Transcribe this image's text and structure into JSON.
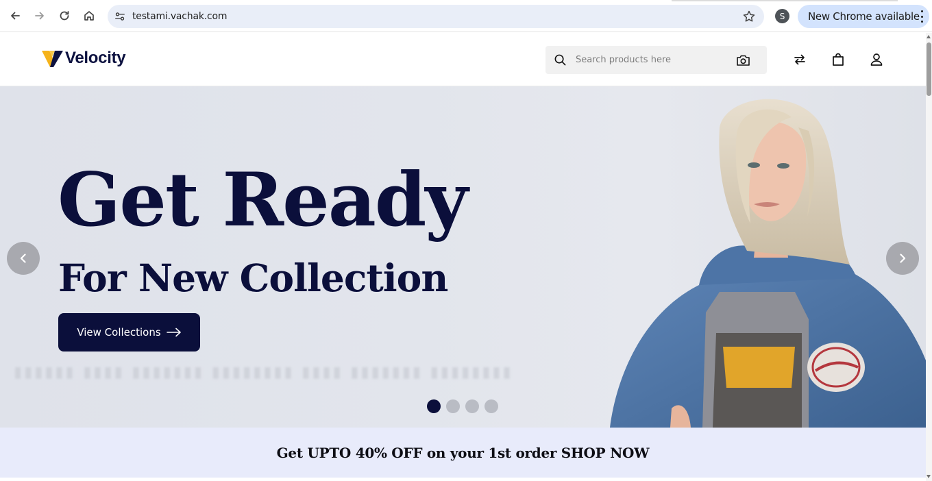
{
  "browser": {
    "url": "testami.vachak.com",
    "profile_initial": "S",
    "update_label": "New Chrome available",
    "icons": [
      "back-icon",
      "forward-icon",
      "reload-icon",
      "home-icon",
      "site-info-icon",
      "star-icon",
      "kebab-menu-icon"
    ]
  },
  "header": {
    "brand": "Velocity",
    "search_placeholder": "Search products here",
    "icons": [
      "search-icon",
      "camera-icon",
      "compare-icon",
      "bag-icon",
      "user-icon"
    ]
  },
  "hero": {
    "title_line1": "Get Ready",
    "title_line2": "For New Collection",
    "cta_label": "View Collections",
    "slides_count": 4,
    "active_slide": 1
  },
  "promo": {
    "text": "Get UPTO 40% OFF on your 1st order SHOP NOW"
  },
  "colors": {
    "brand_navy": "#0b0f3b",
    "logo_yellow": "#f5b31b",
    "promo_bg": "#e8ebfb",
    "chrome_update_bg": "#d3e3fd"
  }
}
